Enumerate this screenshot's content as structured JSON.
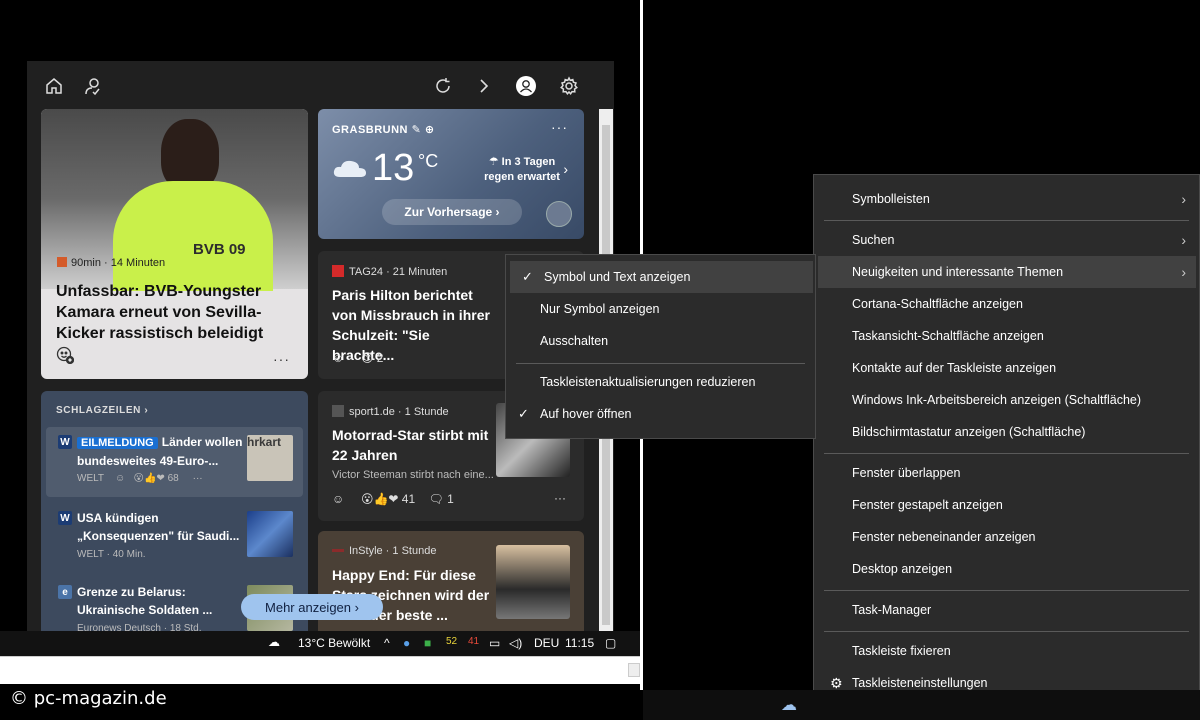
{
  "watermark": "© pc-magazin.de",
  "cards": {
    "bvb": {
      "jersey_text": "BVB 09",
      "source": "90min · 14 Minuten",
      "title": "Unfassbar: BVB-Youngster Kamara erneut von Sevilla-Kicker rassistisch beleidigt",
      "more": "···"
    },
    "weather": {
      "location": "GRASBRUNN",
      "temp": "13",
      "unit": "°C",
      "forecast_line1": "In 3 Tagen",
      "forecast_line2": "regen erwartet",
      "button": "Zur Vorhersage ›",
      "dots": "···"
    },
    "tag24": {
      "source": "TAG24 · 21 Minuten",
      "title": "Paris Hilton berichtet von Missbrauch in ihrer Schulzeit: \"Sie brachte...",
      "reactions": "2"
    },
    "sport": {
      "source": "sport1.de · 1 Stunde",
      "title": "Motorrad-Star stirbt mit 22 Jahren",
      "sub": "Victor Steeman stirbt nach eine...",
      "reactions": "41",
      "comments": "1",
      "more": "···"
    },
    "instyle": {
      "source": "InStyle · 1 Stunde",
      "title": "Happy End: Für diese Stars zeichnen wird der Serie der beste ..."
    },
    "headlines": {
      "title": "SCHLAGZEILEN ›",
      "items": [
        {
          "badge": "EILMELDUNG",
          "text": "Länder wollen bundesweites 49-Euro-...",
          "meta": "WELT",
          "reactions": "68",
          "thumb_text": "hrkart"
        },
        {
          "text": "USA kündigen „Konsequenzen\" für Saudi...",
          "meta": "WELT · 40 Min."
        },
        {
          "text": "Grenze zu Belarus: Ukrainische Soldaten ...",
          "meta": "Euronews Deutsch · 18 Std."
        }
      ]
    },
    "mehr_button": "Mehr anzeigen ›"
  },
  "left_taskbar": {
    "weather": "13°C  Bewölkt",
    "num1": "52",
    "num2": "41",
    "lang": "DEU",
    "time": "11:15"
  },
  "submenu": {
    "items": [
      {
        "label": "Symbol und Text anzeigen",
        "checked": true
      },
      {
        "label": "Nur Symbol anzeigen"
      },
      {
        "label": "Ausschalten"
      },
      {
        "label": "Taskleistenaktualisierungen reduzieren"
      },
      {
        "label": "Auf hover öffnen",
        "checked": true
      }
    ],
    "check_glyph": "✓"
  },
  "context_menu": {
    "items": [
      "Symbolleisten",
      "Suchen",
      "Neuigkeiten und interessante Themen",
      "Cortana-Schaltfläche anzeigen",
      "Taskansicht-Schaltfläche anzeigen",
      "Kontakte auf der Taskleiste anzeigen",
      "Windows Ink-Arbeitsbereich anzeigen (Schaltfläche)",
      "Bildschirmtastatur anzeigen (Schaltfläche)",
      "Fenster überlappen",
      "Fenster gestapelt anzeigen",
      "Fenster nebeneinander anzeigen",
      "Desktop anzeigen",
      "Task-Manager",
      "Taskleiste fixieren",
      "Taskleisteneinstellungen"
    ],
    "arrow_glyph": "›"
  },
  "colors": {
    "menu_bg": "#2b2b2b",
    "menu_hover": "#414141",
    "accent_badge": "#1a6fd1",
    "mehr_button": "#9fc4ee"
  },
  "icons": {
    "home": "home-icon",
    "weather_header": "weather-person-icon",
    "refresh": "refresh-icon",
    "forward": "chevron-right-icon",
    "avatar": "avatar-icon",
    "settings": "gear-icon"
  }
}
